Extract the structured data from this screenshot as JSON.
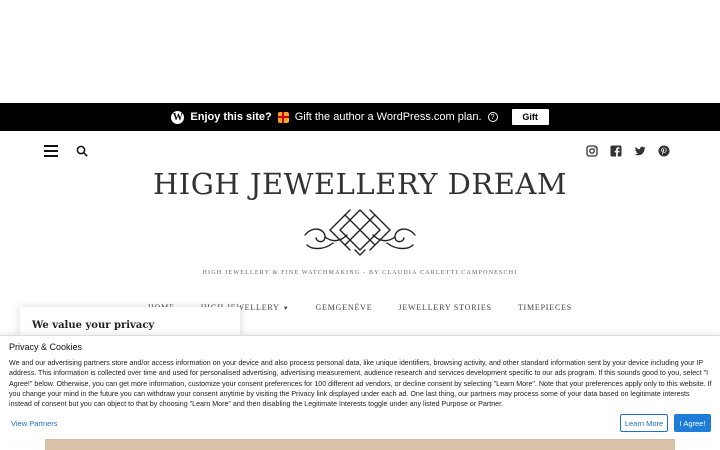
{
  "promo": {
    "enjoy_text": "Enjoy this site?",
    "gift_text": "Gift the author a WordPress.com plan.",
    "gift_button": "Gift"
  },
  "header": {
    "icons": [
      "menu-icon",
      "search-icon"
    ],
    "social_icons": [
      "instagram-icon",
      "facebook-icon",
      "twitter-icon",
      "pinterest-icon"
    ]
  },
  "site": {
    "title": "HIGH JEWELLERY DREAM",
    "tagline": "HIGH JEWELLERY & FINE WATCHMAKING - BY CLAUDIA CARLETTI CAMPONESCHI"
  },
  "nav": {
    "items": [
      "HOME",
      "HIGH JEWELLERY",
      "GEMGENÈVE",
      "JEWELLERY STORIES",
      "TIMEPIECES"
    ]
  },
  "privacy_card": {
    "title": "We value your privacy"
  },
  "cookie": {
    "title": "Privacy & Cookies",
    "text": "We and our advertising partners store and/or access information on your device and also process personal data, like unique identifiers, browsing activity, and other standard information sent by your device including your IP address. This information is collected over time and used for personalised advertising, advertising measurement, audience research and services development specific to our ads program. If this sounds good to you, select \"I Agree!\" below. Otherwise, you can get more information, customize your consent preferences for 100 different ad vendors, or decline consent by selecting \"Learn More\". Note that your preferences apply only to this website. If you change your mind in the future you can withdraw your consent anytime by visiting the Privacy link displayed under each ad. One last thing, our partners may process some of your data based on legitimate interests instead of consent but you can object to that by choosing \"Learn More\" and then disabling the Legitimate Interests toggle under any listed Purpose or Partner.",
    "view_partners": "View Partners",
    "learn_more": "Learn More",
    "agree": "I Agree!"
  },
  "colors": {
    "promo_bg": "#000000",
    "link_blue": "#1e6fd1",
    "agree_bg": "#1e7dd8"
  }
}
